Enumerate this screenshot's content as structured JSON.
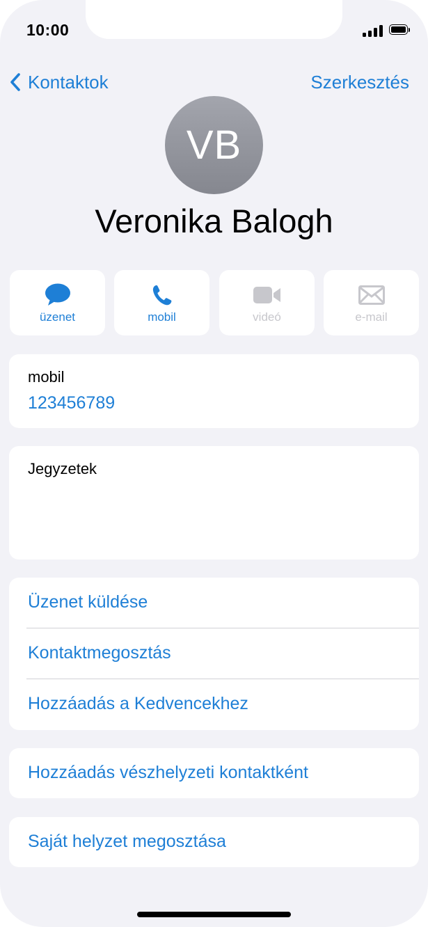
{
  "status_bar": {
    "time": "10:00",
    "signal_icon": "cellular-signal-icon",
    "battery_icon": "battery-icon"
  },
  "nav": {
    "back_label": "Kontaktok",
    "back_icon": "chevron-left-icon",
    "edit_label": "Szerkesztés"
  },
  "contact": {
    "initials": "VB",
    "name": "Veronika Balogh"
  },
  "actions": [
    {
      "label": "üzenet",
      "icon": "message-bubble-icon",
      "enabled": true
    },
    {
      "label": "mobil",
      "icon": "phone-icon",
      "enabled": true
    },
    {
      "label": "videó",
      "icon": "video-camera-icon",
      "enabled": false
    },
    {
      "label": "e-mail",
      "icon": "envelope-icon",
      "enabled": false
    }
  ],
  "phone_field": {
    "label": "mobil",
    "value": "123456789"
  },
  "notes": {
    "label": "Jegyzetek"
  },
  "options": {
    "send_message": "Üzenet küldése",
    "share_contact": "Kontaktmegosztás",
    "add_favorites": "Hozzáadás a Kedvencekhez",
    "add_emergency": "Hozzáadás vészhelyzeti kontaktként",
    "share_location": "Saját helyzet megosztása"
  },
  "colors": {
    "accent": "#1e7fd6",
    "background": "#f2f2f7",
    "disabled": "#c7c7cc"
  }
}
